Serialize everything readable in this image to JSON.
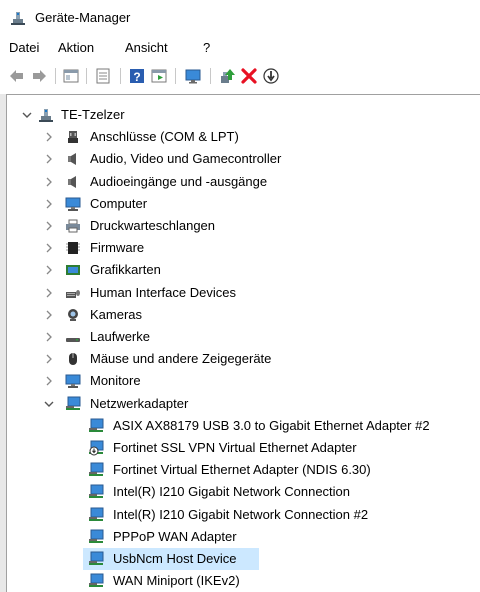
{
  "window": {
    "title": "Geräte-Manager"
  },
  "menu": [
    "Datei",
    "Aktion",
    "Ansicht",
    "?"
  ],
  "toolbar": {
    "icons": [
      "back-arrow-icon",
      "forward-arrow-icon",
      "show-hide-console-tree-icon",
      "properties-icon",
      "help-icon",
      "action-pane-icon",
      "scan-monitor-icon",
      "update-driver-icon",
      "uninstall-x-icon",
      "disable-device-icon"
    ]
  },
  "tree": {
    "root": {
      "label": "TE-Tzelzer",
      "expanded": true
    },
    "categories": [
      {
        "label": "Anschlüsse (COM & LPT)",
        "icon": "port-icon",
        "expanded": false
      },
      {
        "label": "Audio, Video und Gamecontroller",
        "icon": "speaker-icon",
        "expanded": false
      },
      {
        "label": "Audioeingänge und -ausgänge",
        "icon": "speaker-icon",
        "expanded": false
      },
      {
        "label": "Computer",
        "icon": "computer-icon",
        "expanded": false
      },
      {
        "label": "Druckwarteschlangen",
        "icon": "printer-icon",
        "expanded": false
      },
      {
        "label": "Firmware",
        "icon": "firmware-chip-icon",
        "expanded": false
      },
      {
        "label": "Grafikkarten",
        "icon": "display-adapter-icon",
        "expanded": false
      },
      {
        "label": "Human Interface Devices",
        "icon": "hid-icon",
        "expanded": false
      },
      {
        "label": "Kameras",
        "icon": "camera-icon",
        "expanded": false
      },
      {
        "label": "Laufwerke",
        "icon": "drive-icon",
        "expanded": false
      },
      {
        "label": "Mäuse und andere Zeigegeräte",
        "icon": "mouse-icon",
        "expanded": false
      },
      {
        "label": "Monitore",
        "icon": "monitor-icon",
        "expanded": false
      },
      {
        "label": "Netzwerkadapter",
        "icon": "network-adapter-icon",
        "expanded": true
      }
    ],
    "network_adapters": [
      {
        "label": "ASIX AX88179 USB 3.0 to Gigabit Ethernet Adapter #2",
        "icon": "network-adapter-icon"
      },
      {
        "label": "Fortinet SSL VPN Virtual Ethernet Adapter",
        "icon": "network-adapter-warning-icon"
      },
      {
        "label": "Fortinet Virtual Ethernet Adapter (NDIS 6.30)",
        "icon": "network-adapter-icon"
      },
      {
        "label": "Intel(R) I210 Gigabit Network Connection",
        "icon": "network-adapter-icon"
      },
      {
        "label": "Intel(R) I210 Gigabit Network Connection #2",
        "icon": "network-adapter-icon"
      },
      {
        "label": "PPPoP WAN Adapter",
        "icon": "network-adapter-icon"
      },
      {
        "label": "UsbNcm Host Device",
        "icon": "network-adapter-icon",
        "selected": true
      },
      {
        "label": "WAN Miniport (IKEv2)",
        "icon": "network-adapter-icon"
      }
    ]
  },
  "colors": {
    "selection": "#cce8ff",
    "accent_blue": "#1e78c8",
    "uninstall_red": "#e81123",
    "update_green": "#2e9e3a"
  }
}
